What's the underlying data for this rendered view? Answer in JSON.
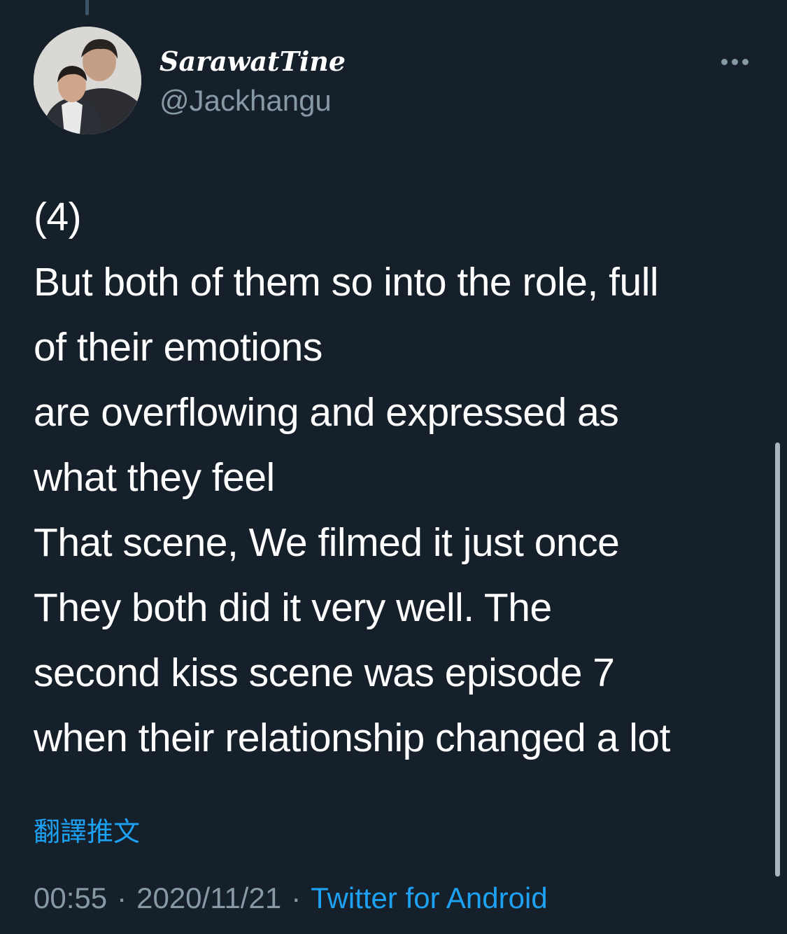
{
  "author": {
    "display_name": "SarawatTine",
    "handle": "@Jackhangu"
  },
  "tweet": {
    "lines": [
      "(4)",
      "But both of them so into the role, full",
      "of their emotions",
      "are overflowing and expressed as",
      "what they feel",
      "That scene, We filmed it just once",
      "They both did it very well. The",
      "second kiss scene was episode 7",
      "when their relationship changed a lot"
    ]
  },
  "translate_link": "翻譯推文",
  "meta": {
    "time": "00:55",
    "separator": "·",
    "date": "2020/11/21",
    "source": "Twitter for Android"
  },
  "icons": {
    "more": "more-horizontal-icon"
  },
  "colors": {
    "background": "#15202b",
    "primary_text": "#ffffff",
    "secondary_text": "#8899a6",
    "link": "#1da1f2"
  }
}
